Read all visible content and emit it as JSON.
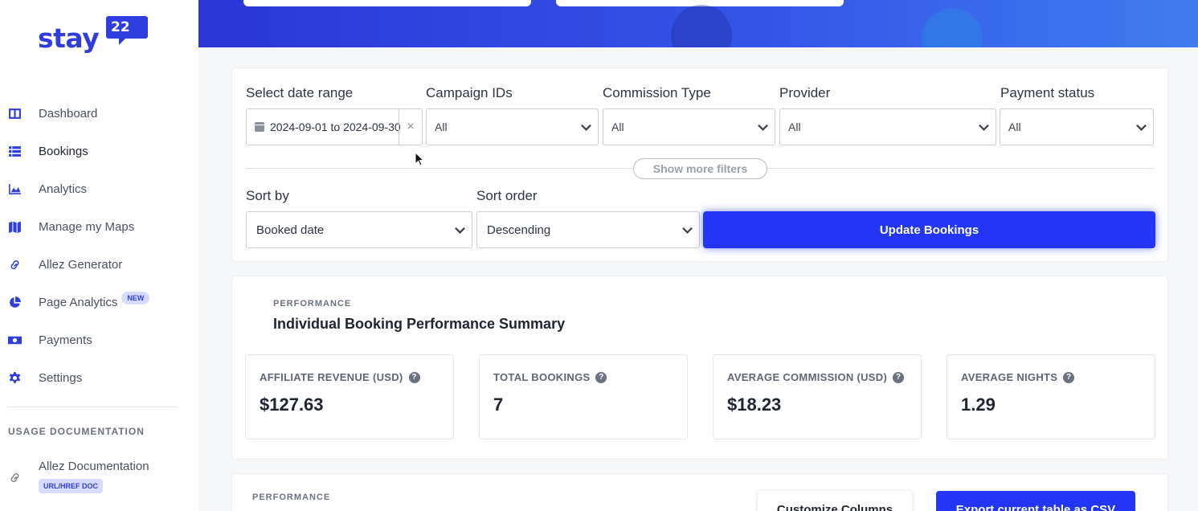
{
  "brand": {
    "name": "stay",
    "badge": "22",
    "accent": "#2f3ddf"
  },
  "sidebar": {
    "items": [
      {
        "label": "Dashboard",
        "icon": "dashboard-icon"
      },
      {
        "label": "Bookings",
        "icon": "list-icon",
        "active": true
      },
      {
        "label": "Analytics",
        "icon": "area-chart-icon"
      },
      {
        "label": "Manage my Maps",
        "icon": "map-icon"
      },
      {
        "label": "Allez Generator",
        "icon": "link-icon"
      },
      {
        "label": "Page Analytics",
        "icon": "pie-chart-icon",
        "badge": "NEW"
      },
      {
        "label": "Payments",
        "icon": "money-icon"
      },
      {
        "label": "Settings",
        "icon": "gear-icon"
      }
    ],
    "usage_title": "USAGE DOCUMENTATION",
    "doc_item": {
      "label": "Allez Documentation",
      "badge": "URL/HREF DOC",
      "icon": "link-icon"
    }
  },
  "filters": {
    "date_range": {
      "label": "Select date range",
      "value": "2024-09-01 to 2024-09-30",
      "clear": "×"
    },
    "campaign_ids": {
      "label": "Campaign IDs",
      "value": "All"
    },
    "commission_type": {
      "label": "Commission Type",
      "value": "All"
    },
    "provider": {
      "label": "Provider",
      "value": "All"
    },
    "payment_status": {
      "label": "Payment status",
      "value": "All"
    },
    "show_more": "Show more filters",
    "sort_by": {
      "label": "Sort by",
      "value": "Booked date"
    },
    "sort_order": {
      "label": "Sort order",
      "value": "Descending"
    },
    "update_button": "Update Bookings"
  },
  "performance": {
    "eyebrow": "PERFORMANCE",
    "title": "Individual Booking Performance Summary",
    "cards": [
      {
        "label": "AFFILIATE REVENUE (USD)",
        "value": "$127.63"
      },
      {
        "label": "TOTAL BOOKINGS",
        "value": "7"
      },
      {
        "label": "AVERAGE COMMISSION (USD)",
        "value": "$18.23"
      },
      {
        "label": "AVERAGE NIGHTS",
        "value": "1.29"
      }
    ]
  },
  "table_section": {
    "eyebrow": "PERFORMANCE",
    "customize_button": "Customize Columns",
    "export_button": "Export current table as CSV"
  }
}
